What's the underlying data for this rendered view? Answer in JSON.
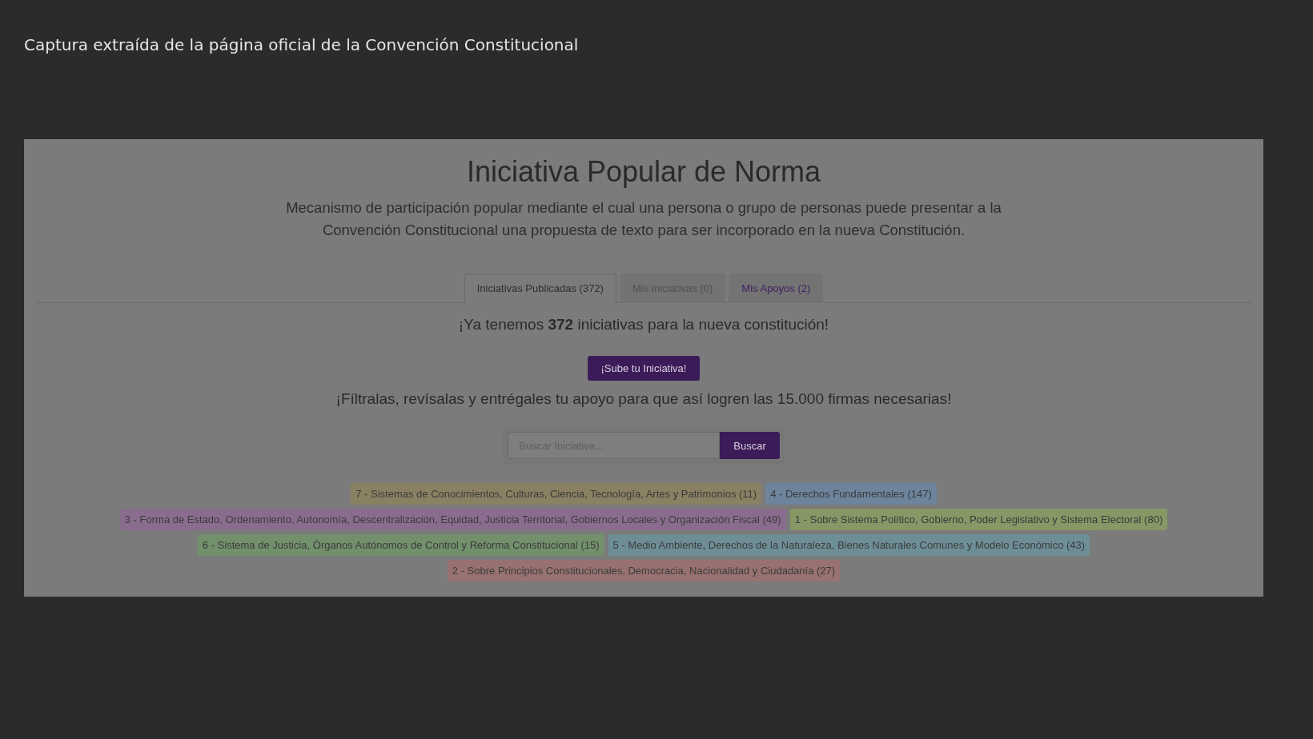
{
  "caption": "Captura extraída de la página oficial de la Convención Constitucional",
  "page": {
    "title": "Iniciativa Popular de Norma",
    "description": "Mecanismo de participación popular mediante el cual una persona o grupo de personas puede presentar a la Convención Constitucional una propuesta de texto para ser incorporado en la nueva Constitución.",
    "tabs": [
      {
        "label": "Iniciativas Publicadas (372)",
        "selected": true,
        "disabled": false
      },
      {
        "label": "Mis Iniciativas (0)",
        "selected": false,
        "disabled": true
      },
      {
        "label": "Mis Apoyos (2)",
        "selected": false,
        "disabled": false
      }
    ],
    "headline": "¡Ya tenemos **372** iniciativas para la nueva constitución!",
    "upload_button": "¡Sube tu Iniciativa!",
    "call_to_action": "¡Fíltralas, revísalas y entrégales tu apoyo para que así logren las 15.000 firmas necesarias!",
    "search": {
      "placeholder": "Buscar Iniciativa...",
      "button": "Buscar"
    },
    "category_rows": [
      [
        {
          "label": "7 - Sistemas de Conocimientos, Culturas, Ciencia, Tecnología, Artes y Patrimonios (11)",
          "color": "#8a8062"
        },
        {
          "label": "4 - Derechos Fundamentales (147)",
          "color": "#6d849c"
        }
      ],
      [
        {
          "label": "3 - Forma de Estado, Ordenamiento, Autonomía, Descentralización, Equidad, Justicia Territorial, Gobiernos Locales y Organización Fiscal (49)",
          "color": "#8a6d8e"
        },
        {
          "label": "1 - Sobre Sistema Político, Gobierno, Poder Legislativo y Sistema Electoral (80)",
          "color": "#879766"
        }
      ],
      [
        {
          "label": "6 - Sistema de Justicia, Órganos Autónomos de Control y Reforma Constitucional (15)",
          "color": "#72906c"
        },
        {
          "label": "5 - Medio Ambiente, Derechos de la Naturaleza, Bienes Naturales Comunes y Modelo Económico (43)",
          "color": "#6e8e96"
        }
      ],
      [
        {
          "label": "2 - Sobre Principios Constitucionales, Democracia, Nacionalidad y Ciudadanía (27)",
          "color": "#977270"
        }
      ]
    ]
  }
}
